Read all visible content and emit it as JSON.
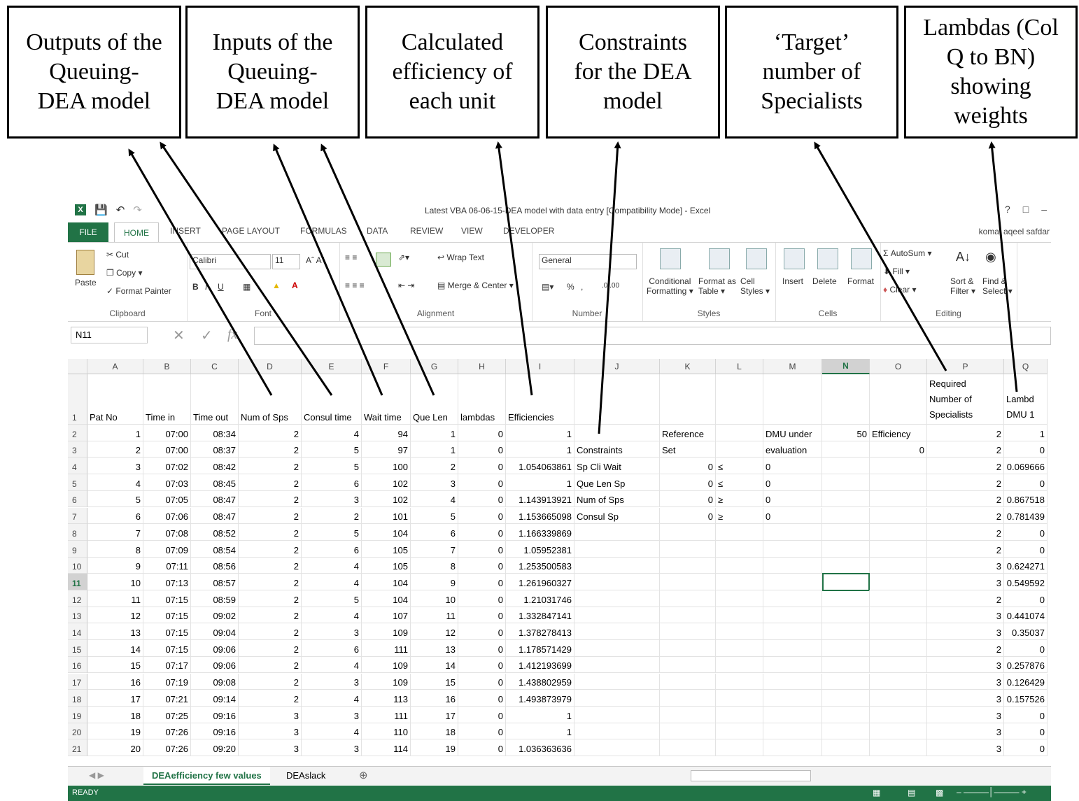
{
  "callouts": [
    "Outputs of the\nQueuing-\nDEA model",
    "Inputs of the\nQueuing-\nDEA model",
    "Calculated\nefficiency of\neach unit",
    "Constraints\nfor the DEA\nmodel",
    "‘Target’\nnumber of\nSpecialists",
    "Lambdas (Col\nQ to BN)\nshowing\nweights"
  ],
  "window": {
    "title": "Latest VBA 06-06-15-DEA model with data entry [Compatibility Mode] - Excel",
    "user": "komal aqeel safdar"
  },
  "tabs": [
    "FILE",
    "HOME",
    "INSERT",
    "PAGE LAYOUT",
    "FORMULAS",
    "DATA",
    "REVIEW",
    "VIEW",
    "DEVELOPER"
  ],
  "ribbon": {
    "clipboard": {
      "label": "Clipboard",
      "paste": "Paste",
      "cut": "Cut",
      "copy": "Copy",
      "format_painter": "Format Painter"
    },
    "font": {
      "label": "Font",
      "name": "Calibri",
      "size": "11"
    },
    "alignment": {
      "label": "Alignment",
      "wrap": "Wrap Text",
      "merge": "Merge & Center"
    },
    "number": {
      "label": "Number",
      "format": "General",
      "pct": "%"
    },
    "styles": {
      "label": "Styles",
      "cond": "Conditional",
      "cond2": "Formatting",
      "fmt_table": "Format as",
      "fmt_table2": "Table",
      "cell_styles": "Cell",
      "cell_styles2": "Styles"
    },
    "cells": {
      "label": "Cells",
      "insert": "Insert",
      "delete": "Delete",
      "format": "Format"
    },
    "editing": {
      "label": "Editing",
      "autosum": "AutoSum",
      "fill": "Fill",
      "clear": "Clear",
      "sort": "Sort &",
      "sort2": "Filter",
      "find": "Find &",
      "find2": "Select"
    }
  },
  "name_box": "N11",
  "fx": "fx",
  "columns": [
    "A",
    "B",
    "C",
    "D",
    "E",
    "F",
    "G",
    "H",
    "I",
    "J",
    "K",
    "L",
    "M",
    "N",
    "O",
    "P",
    "Q"
  ],
  "selected_column": "N",
  "selected_row": "11",
  "header_row": {
    "A": "Pat No",
    "B": "Time in",
    "C": "Time out",
    "D": "Num of Sps",
    "E": "Consul time",
    "F": "Wait time",
    "G": "Que Len",
    "H": "lambdas",
    "I": "Efficiencies",
    "P_line1": "Required",
    "P_line2": "Number of",
    "P_line3": "Specialists",
    "Q_line1": "Lambd",
    "Q_line2": "DMU 1"
  },
  "rows": [
    {
      "n": "2",
      "A": "1",
      "B": "07:00",
      "C": "08:34",
      "D": "2",
      "E": "4",
      "F": "94",
      "G": "1",
      "H": "0",
      "I": "1",
      "J": "",
      "K": "Reference",
      "L": "",
      "M": "DMU under",
      "N": "50",
      "O": "Efficiency",
      "P": "2",
      "Q": "1"
    },
    {
      "n": "3",
      "A": "2",
      "B": "07:00",
      "C": "08:37",
      "D": "2",
      "E": "5",
      "F": "97",
      "G": "1",
      "H": "0",
      "I": "1",
      "J": "Constraints",
      "K": "Set",
      "L": "",
      "M": "evaluation",
      "N": "",
      "O": "0",
      "P": "2",
      "Q": "0"
    },
    {
      "n": "4",
      "A": "3",
      "B": "07:02",
      "C": "08:42",
      "D": "2",
      "E": "5",
      "F": "100",
      "G": "2",
      "H": "0",
      "I": "1.054063861",
      "J": "Sp Cli Wait",
      "K": "0",
      "L": "≤",
      "M": "0",
      "N": "",
      "O": "",
      "P": "2",
      "Q": "0.069666"
    },
    {
      "n": "5",
      "A": "4",
      "B": "07:03",
      "C": "08:45",
      "D": "2",
      "E": "6",
      "F": "102",
      "G": "3",
      "H": "0",
      "I": "1",
      "J": "Que Len Sp",
      "K": "0",
      "L": "≤",
      "M": "0",
      "N": "",
      "O": "",
      "P": "2",
      "Q": "0"
    },
    {
      "n": "6",
      "A": "5",
      "B": "07:05",
      "C": "08:47",
      "D": "2",
      "E": "3",
      "F": "102",
      "G": "4",
      "H": "0",
      "I": "1.143913921",
      "J": "Num of Sps",
      "K": "0",
      "L": "≥",
      "M": "0",
      "N": "",
      "O": "",
      "P": "2",
      "Q": "0.867518"
    },
    {
      "n": "7",
      "A": "6",
      "B": "07:06",
      "C": "08:47",
      "D": "2",
      "E": "2",
      "F": "101",
      "G": "5",
      "H": "0",
      "I": "1.153665098",
      "J": "Consul Sp",
      "K": "0",
      "L": "≥",
      "M": "0",
      "N": "",
      "O": "",
      "P": "2",
      "Q": "0.781439"
    },
    {
      "n": "8",
      "A": "7",
      "B": "07:08",
      "C": "08:52",
      "D": "2",
      "E": "5",
      "F": "104",
      "G": "6",
      "H": "0",
      "I": "1.166339869",
      "J": "",
      "K": "",
      "L": "",
      "M": "",
      "N": "",
      "O": "",
      "P": "2",
      "Q": "0"
    },
    {
      "n": "9",
      "A": "8",
      "B": "07:09",
      "C": "08:54",
      "D": "2",
      "E": "6",
      "F": "105",
      "G": "7",
      "H": "0",
      "I": "1.05952381",
      "J": "",
      "K": "",
      "L": "",
      "M": "",
      "N": "",
      "O": "",
      "P": "2",
      "Q": "0"
    },
    {
      "n": "10",
      "A": "9",
      "B": "07:11",
      "C": "08:56",
      "D": "2",
      "E": "4",
      "F": "105",
      "G": "8",
      "H": "0",
      "I": "1.253500583",
      "J": "",
      "K": "",
      "L": "",
      "M": "",
      "N": "",
      "O": "",
      "P": "3",
      "Q": "0.624271"
    },
    {
      "n": "11",
      "A": "10",
      "B": "07:13",
      "C": "08:57",
      "D": "2",
      "E": "4",
      "F": "104",
      "G": "9",
      "H": "0",
      "I": "1.261960327",
      "J": "",
      "K": "",
      "L": "",
      "M": "",
      "N": "",
      "O": "",
      "P": "3",
      "Q": "0.549592"
    },
    {
      "n": "12",
      "A": "11",
      "B": "07:15",
      "C": "08:59",
      "D": "2",
      "E": "5",
      "F": "104",
      "G": "10",
      "H": "0",
      "I": "1.21031746",
      "J": "",
      "K": "",
      "L": "",
      "M": "",
      "N": "",
      "O": "",
      "P": "2",
      "Q": "0"
    },
    {
      "n": "13",
      "A": "12",
      "B": "07:15",
      "C": "09:02",
      "D": "2",
      "E": "4",
      "F": "107",
      "G": "11",
      "H": "0",
      "I": "1.332847141",
      "J": "",
      "K": "",
      "L": "",
      "M": "",
      "N": "",
      "O": "",
      "P": "3",
      "Q": "0.441074"
    },
    {
      "n": "14",
      "A": "13",
      "B": "07:15",
      "C": "09:04",
      "D": "2",
      "E": "3",
      "F": "109",
      "G": "12",
      "H": "0",
      "I": "1.378278413",
      "J": "",
      "K": "",
      "L": "",
      "M": "",
      "N": "",
      "O": "",
      "P": "3",
      "Q": "0.35037"
    },
    {
      "n": "15",
      "A": "14",
      "B": "07:15",
      "C": "09:06",
      "D": "2",
      "E": "6",
      "F": "111",
      "G": "13",
      "H": "0",
      "I": "1.178571429",
      "J": "",
      "K": "",
      "L": "",
      "M": "",
      "N": "",
      "O": "",
      "P": "2",
      "Q": "0"
    },
    {
      "n": "16",
      "A": "15",
      "B": "07:17",
      "C": "09:06",
      "D": "2",
      "E": "4",
      "F": "109",
      "G": "14",
      "H": "0",
      "I": "1.412193699",
      "J": "",
      "K": "",
      "L": "",
      "M": "",
      "N": "",
      "O": "",
      "P": "3",
      "Q": "0.257876"
    },
    {
      "n": "17",
      "A": "16",
      "B": "07:19",
      "C": "09:08",
      "D": "2",
      "E": "3",
      "F": "109",
      "G": "15",
      "H": "0",
      "I": "1.438802959",
      "J": "",
      "K": "",
      "L": "",
      "M": "",
      "N": "",
      "O": "",
      "P": "3",
      "Q": "0.126429"
    },
    {
      "n": "18",
      "A": "17",
      "B": "07:21",
      "C": "09:14",
      "D": "2",
      "E": "4",
      "F": "113",
      "G": "16",
      "H": "0",
      "I": "1.493873979",
      "J": "",
      "K": "",
      "L": "",
      "M": "",
      "N": "",
      "O": "",
      "P": "3",
      "Q": "0.157526"
    },
    {
      "n": "19",
      "A": "18",
      "B": "07:25",
      "C": "09:16",
      "D": "3",
      "E": "3",
      "F": "111",
      "G": "17",
      "H": "0",
      "I": "1",
      "J": "",
      "K": "",
      "L": "",
      "M": "",
      "N": "",
      "O": "",
      "P": "3",
      "Q": "0"
    },
    {
      "n": "20",
      "A": "19",
      "B": "07:26",
      "C": "09:16",
      "D": "3",
      "E": "4",
      "F": "110",
      "G": "18",
      "H": "0",
      "I": "1",
      "J": "",
      "K": "",
      "L": "",
      "M": "",
      "N": "",
      "O": "",
      "P": "3",
      "Q": "0"
    },
    {
      "n": "21",
      "A": "20",
      "B": "07:26",
      "C": "09:20",
      "D": "3",
      "E": "3",
      "F": "114",
      "G": "19",
      "H": "0",
      "I": "1.036363636",
      "J": "",
      "K": "",
      "L": "",
      "M": "",
      "N": "",
      "O": "",
      "P": "3",
      "Q": "0"
    }
  ],
  "sheets": [
    "DEAefficiency few values",
    "DEAslack"
  ],
  "status": "READY"
}
